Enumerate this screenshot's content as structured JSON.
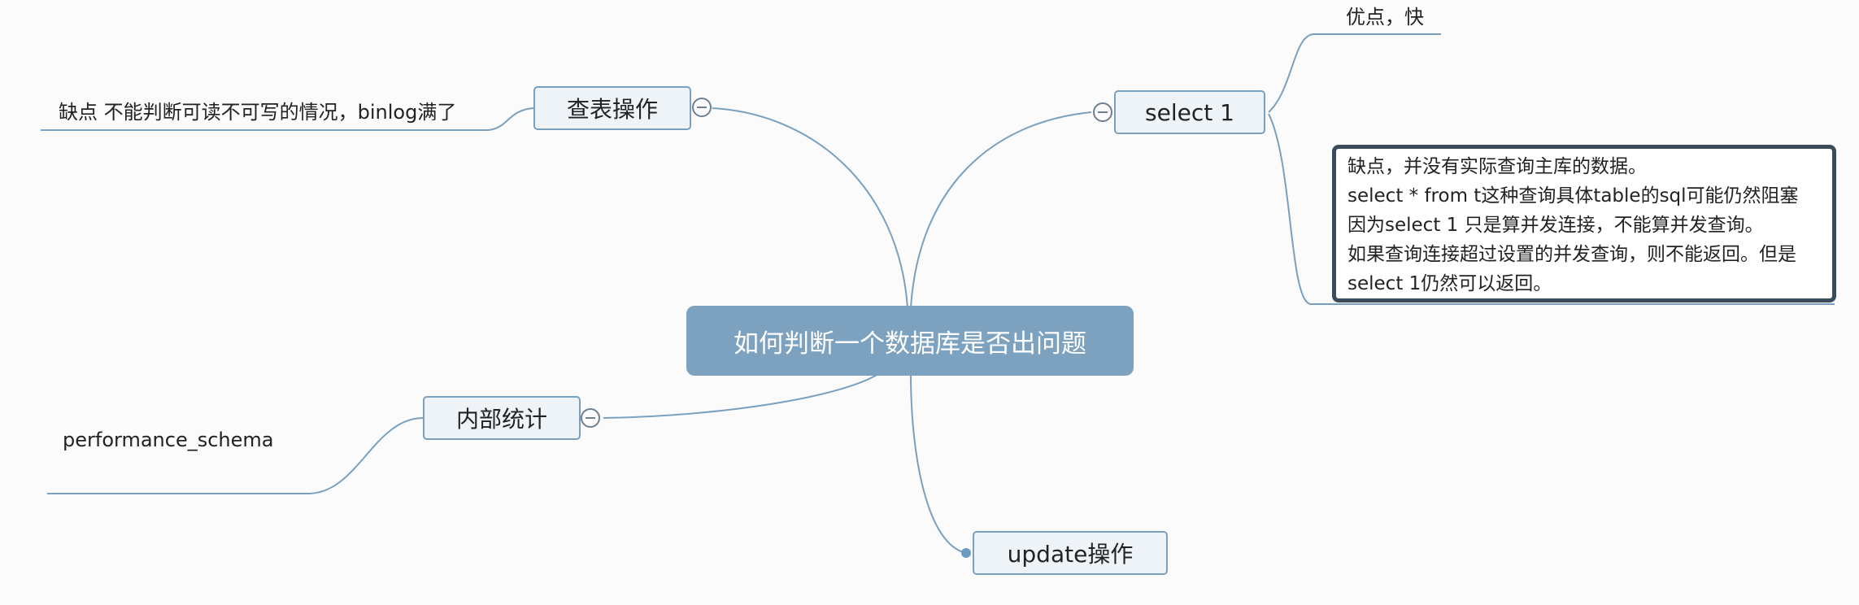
{
  "root": {
    "label": "如何判断一个数据库是否出问题"
  },
  "topics": {
    "table_query": {
      "label": "查表操作",
      "note": "缺点 不能判断可读不可写的情况，binlog满了"
    },
    "select1": {
      "label": "select 1",
      "pro": "优点，快",
      "cons": [
        "缺点，并没有实际查询主库的数据。",
        "select * from t这种查询具体table的sql可能仍然阻塞",
        "因为select 1 只是算并发连接，不能算并发查询。",
        "如果查询连接超过设置的并发查询，则不能返回。但是",
        "select 1仍然可以返回。"
      ]
    },
    "internal_stats": {
      "label": "内部统计",
      "note": "performance_schema"
    },
    "update": {
      "label": "update操作"
    }
  },
  "colors": {
    "line": "#7aa0c0",
    "root_fill": "#7da2bf",
    "node_fill": "#eef3f8",
    "callout_border": "#3a4b5b"
  }
}
